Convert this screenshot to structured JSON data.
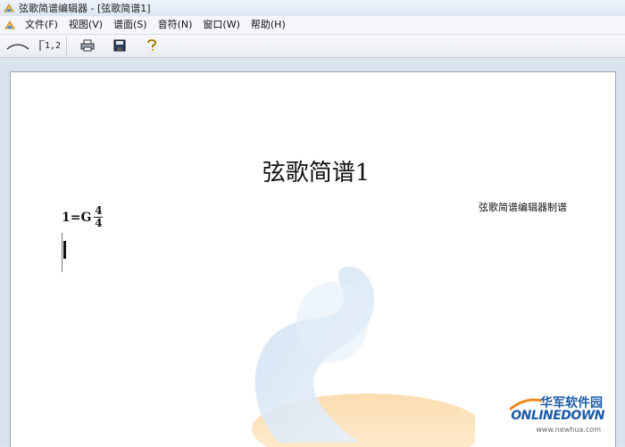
{
  "window": {
    "title": "弦歌简谱编辑器 - [弦歌简谱1]"
  },
  "menu": {
    "items": [
      "文件(F)",
      "视图(V)",
      "谱面(S)",
      "音符(N)",
      "窗口(W)",
      "帮助(H)"
    ]
  },
  "toolbar": {
    "tuplet_label": "1,2",
    "icons": [
      "slur-icon",
      "tuplet-icon",
      "print-icon",
      "save-icon",
      "help-icon"
    ]
  },
  "document": {
    "title": "弦歌简谱1",
    "credit": "弦歌简谱编辑器制谱",
    "key": "1=G",
    "time_numerator": "4",
    "time_denominator": "4"
  },
  "watermark_logo": {
    "chinese": "华军软件园",
    "english": "ONLINEDOWN",
    "url": "www.newhua.com"
  },
  "colors": {
    "workspace": "#d9e3ee",
    "logo_blue": "#1d5ca8",
    "accent_orange": "#f08a1c"
  }
}
